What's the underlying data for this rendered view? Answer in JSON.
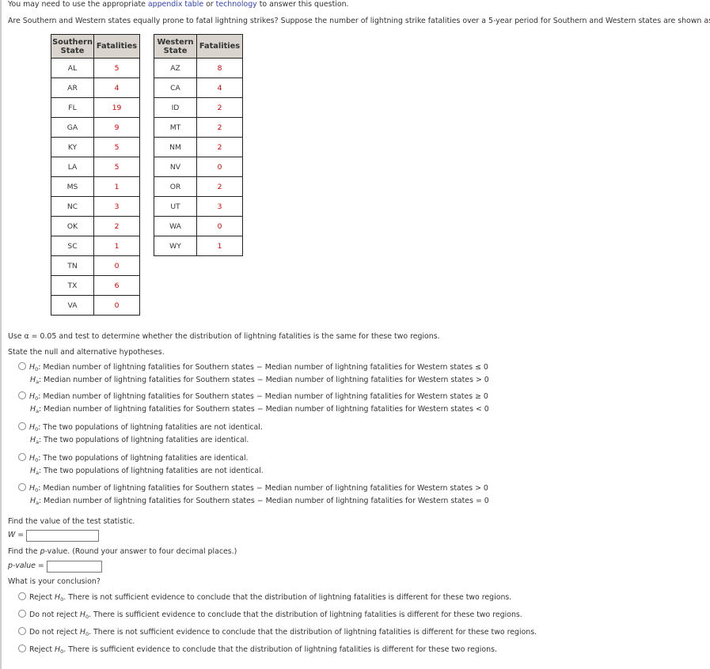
{
  "intro": {
    "prefix": "You may need to use the appropriate ",
    "link1": "appendix table",
    "middle": " or ",
    "link2": "technology",
    "suffix": " to answer this question."
  },
  "question": "Are Southern and Western states equally prone to fatal lightning strikes? Suppose the number of lightning strike fatalities over a 5-year period for Southern and Western states are shown as follows.",
  "southern_table": {
    "headers": [
      "Southern State",
      "Fatalities"
    ],
    "rows": [
      [
        "AL",
        "5"
      ],
      [
        "AR",
        "4"
      ],
      [
        "FL",
        "19"
      ],
      [
        "GA",
        "9"
      ],
      [
        "KY",
        "5"
      ],
      [
        "LA",
        "5"
      ],
      [
        "MS",
        "1"
      ],
      [
        "NC",
        "3"
      ],
      [
        "OK",
        "2"
      ],
      [
        "SC",
        "1"
      ],
      [
        "TN",
        "0"
      ],
      [
        "TX",
        "6"
      ],
      [
        "VA",
        "0"
      ]
    ]
  },
  "western_table": {
    "headers": [
      "Western State",
      "Fatalities"
    ],
    "rows": [
      [
        "AZ",
        "8"
      ],
      [
        "CA",
        "4"
      ],
      [
        "ID",
        "2"
      ],
      [
        "MT",
        "2"
      ],
      [
        "NM",
        "2"
      ],
      [
        "NV",
        "0"
      ],
      [
        "OR",
        "2"
      ],
      [
        "UT",
        "3"
      ],
      [
        "WA",
        "0"
      ],
      [
        "WY",
        "1"
      ]
    ]
  },
  "alpha_text": "Use α = 0.05 and test to determine whether the distribution of lightning fatalities is the same for these two regions.",
  "hypotheses_prompt": "State the null and alternative hypotheses.",
  "hypotheses": [
    {
      "h0": ": Median number of lightning fatalities for Southern states − Median number of lightning fatalities for Western states ≤ 0",
      "ha": ": Median number of lightning fatalities for Southern states − Median number of lightning fatalities for Western states > 0"
    },
    {
      "h0": ": Median number of lightning fatalities for Southern states − Median number of lightning fatalities for Western states ≥ 0",
      "ha": ": Median number of lightning fatalities for Southern states − Median number of lightning fatalities for Western states < 0"
    },
    {
      "h0": ": The two populations of lightning fatalities are not identical.",
      "ha": ": The two populations of lightning fatalities are identical."
    },
    {
      "h0": ": The two populations of lightning fatalities are identical.",
      "ha": ": The two populations of lightning fatalities are not identical."
    },
    {
      "h0": ": Median number of lightning fatalities for Southern states − Median number of lightning fatalities for Western states > 0",
      "ha": ": Median number of lightning fatalities for Southern states − Median number of lightning fatalities for Western states = 0"
    }
  ],
  "h_labels": {
    "H": "H",
    "zero": "0",
    "a": "a"
  },
  "test_stat": {
    "prompt": "Find the value of the test statistic.",
    "label": "W =",
    "value": ""
  },
  "pvalue": {
    "prompt": "Find the p-value. (Round your answer to four decimal places.)",
    "label": "p-value =",
    "value": ""
  },
  "conclusion": {
    "prompt": "What is your conclusion?",
    "options": [
      {
        "action": "Reject ",
        "text": ". There is not sufficient evidence to conclude that the distribution of lightning fatalities is different for these two regions."
      },
      {
        "action": "Do not reject ",
        "text": ". There is sufficient evidence to conclude that the distribution of lightning fatalities is different for these two regions."
      },
      {
        "action": "Do not reject ",
        "text": ". There is not sufficient evidence to conclude that the distribution of lightning fatalities is different for these two regions."
      },
      {
        "action": "Reject ",
        "text": ". There is sufficient evidence to conclude that the distribution of lightning fatalities is different for these two regions."
      }
    ]
  }
}
